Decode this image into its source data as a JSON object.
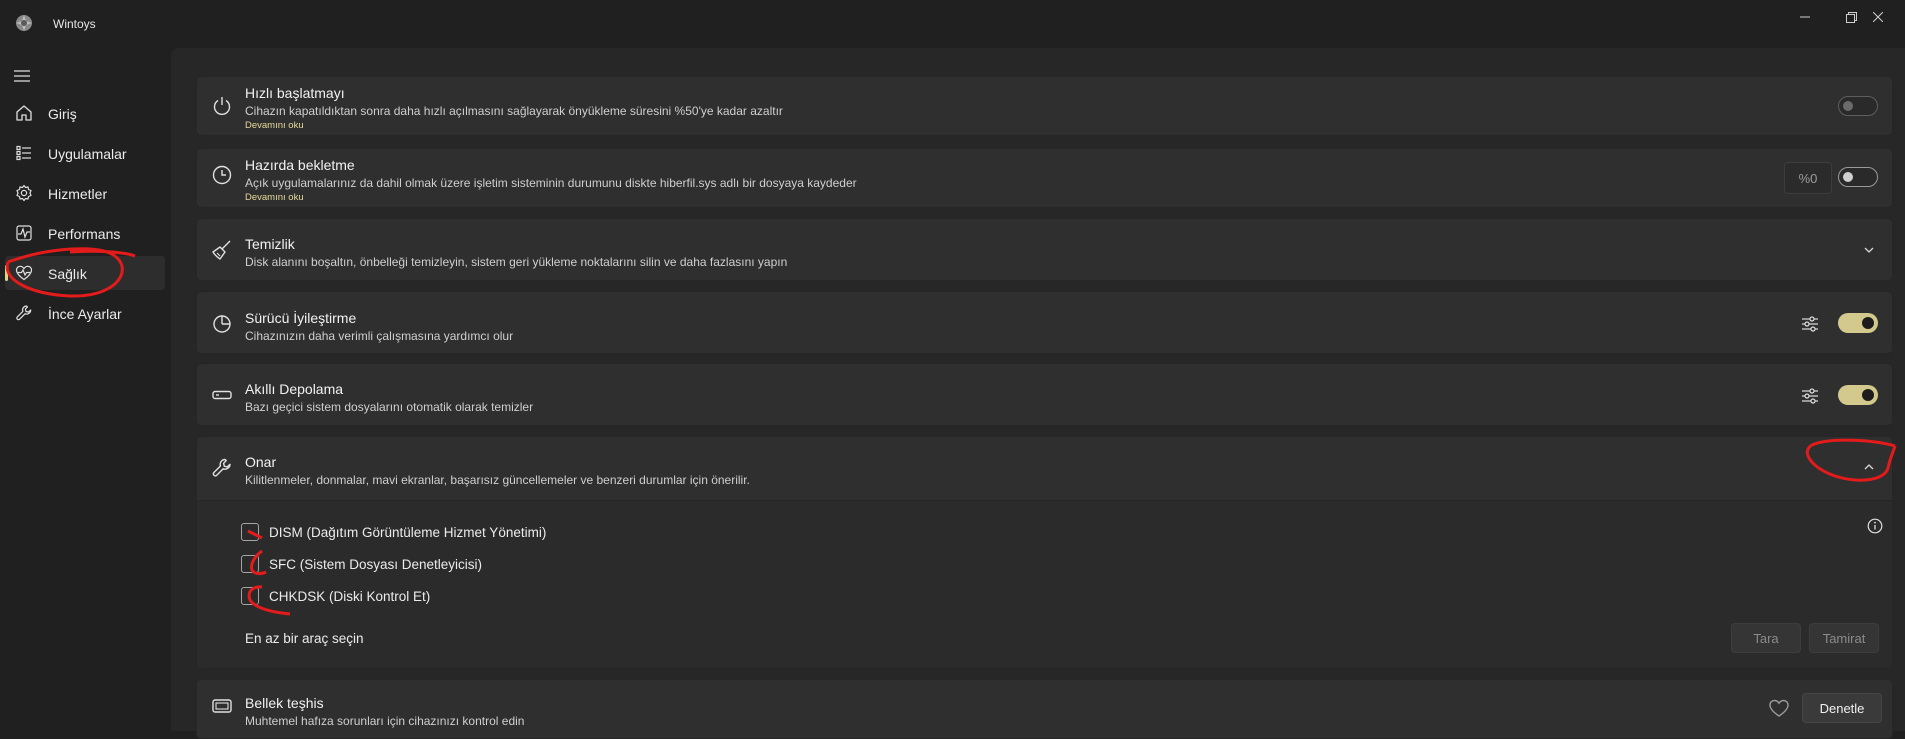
{
  "app": {
    "title": "Wintoys"
  },
  "sidebar": {
    "items": [
      {
        "label": "Giriş",
        "icon": "home-icon"
      },
      {
        "label": "Uygulamalar",
        "icon": "list-icon"
      },
      {
        "label": "Hizmetler",
        "icon": "gear-icon"
      },
      {
        "label": "Performans",
        "icon": "activity-icon"
      },
      {
        "label": "Sağlık",
        "icon": "heart-pulse-icon",
        "active": true
      },
      {
        "label": "İnce Ayarlar",
        "icon": "wrench-icon"
      }
    ]
  },
  "cards": {
    "fast_startup": {
      "title": "Hızlı başlatmayı",
      "desc": "Cihazın kapatıldıktan sonra daha hızlı açılmasını sağlayarak önyükleme süresini %50'ye kadar azaltır",
      "link": "Devamını oku",
      "toggle": "off",
      "icon": "power-icon"
    },
    "hibernate": {
      "title": "Hazırda bekletme",
      "desc": "Açık uygulamalarınız da dahil olmak üzere işletim sisteminin durumunu diskte hiberfil.sys adlı bir dosyaya kaydeder",
      "link": "Devamını oku",
      "percent": "%0",
      "toggle": "off",
      "icon": "clock-icon"
    },
    "cleanup": {
      "title": "Temizlik",
      "desc": "Disk alanını boşaltın, önbelleği temizleyin, sistem geri yükleme noktalarını silin ve daha fazlasını yapın",
      "icon": "broom-icon"
    },
    "driver": {
      "title": "Sürücü İyileştirme",
      "desc": "Cihazınızın daha verimli çalışmasına yardımcı olur",
      "toggle": "on",
      "icon": "pie-chart-icon"
    },
    "storage": {
      "title": "Akıllı Depolama",
      "desc": "Bazı geçici sistem dosyalarını otomatik olarak temizler",
      "toggle": "on",
      "icon": "drive-icon"
    },
    "repair": {
      "title": "Onar",
      "desc": "Kilitlenmeler, donmalar, mavi ekranlar, başarısız güncellemeler ve benzeri durumlar için önerilir.",
      "icon": "wrench-icon",
      "options": [
        "DISM (Dağıtım Görüntüleme Hizmet Yönetimi)",
        "SFC (Sistem Dosyası Denetleyicisi)",
        "CHKDSK (Diski Kontrol Et)"
      ],
      "hint": "En az bir araç seçin",
      "scan_label": "Tara",
      "repair_label": "Tamirat"
    },
    "memory": {
      "title": "Bellek teşhis",
      "desc": "Muhtemel hafıza sorunları için cihazınızı kontrol edin",
      "button": "Denetle",
      "icon": "memory-icon"
    }
  },
  "colors": {
    "accent": "#d4c98d",
    "annotation": "#e31b1b",
    "background": "#202020",
    "card": "#2f2f2f"
  }
}
